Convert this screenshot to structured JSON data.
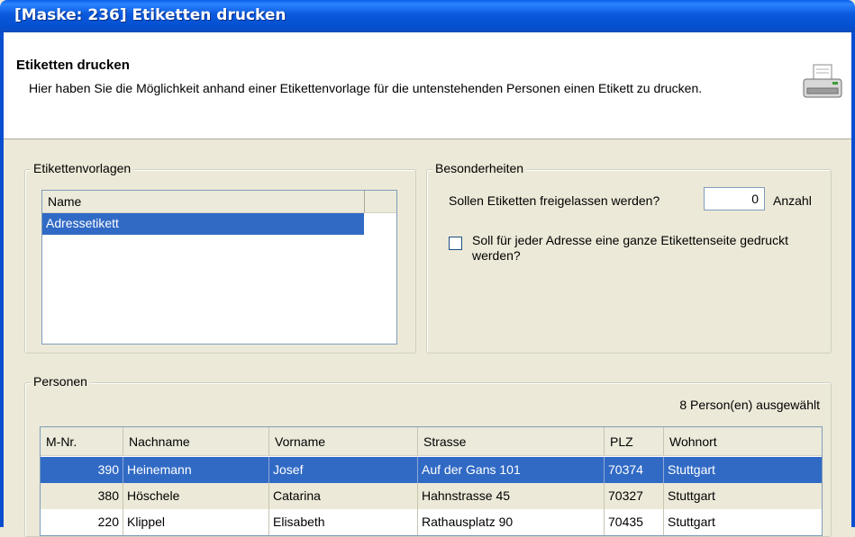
{
  "window": {
    "title": "[Maske: 236] Etiketten drucken"
  },
  "header": {
    "title": "Etiketten drucken",
    "description": "Hier haben Sie die Möglichkeit anhand einer Etikettenvorlage für die untenstehenden Personen einen Etikett zu drucken.",
    "icon": "printer-icon"
  },
  "etikettenvorlagen": {
    "legend": "Etikettenvorlagen",
    "column": "Name",
    "items": [
      "Adressetikett"
    ]
  },
  "besonderheiten": {
    "legend": "Besonderheiten",
    "question": "Sollen Etiketten freigelassen werden?",
    "count_value": "0",
    "count_label": "Anzahl",
    "checkbox_label": "Soll für jeder Adresse eine ganze Etikettenseite gedruckt werden?",
    "checkbox_checked": false
  },
  "personen": {
    "legend": "Personen",
    "selected_count": "8 Person(en) ausgewählt",
    "columns": [
      "M-Nr.",
      "Nachname",
      "Vorname",
      "Strasse",
      "PLZ",
      "Wohnort"
    ],
    "rows": [
      [
        "390",
        "Heinemann",
        "Josef",
        "Auf der Gans 101",
        "70374",
        "Stuttgart"
      ],
      [
        "380",
        "Höschele",
        "Catarina",
        "Hahnstrasse 45",
        "70327",
        "Stuttgart"
      ],
      [
        "220",
        "Klippel",
        "Elisabeth",
        "Rathausplatz 90",
        "70435",
        "Stuttgart"
      ]
    ]
  },
  "colors": {
    "selection": "#316ac5",
    "titlebar": "#0a58dc",
    "dialog_bg": "#ece9d8"
  }
}
